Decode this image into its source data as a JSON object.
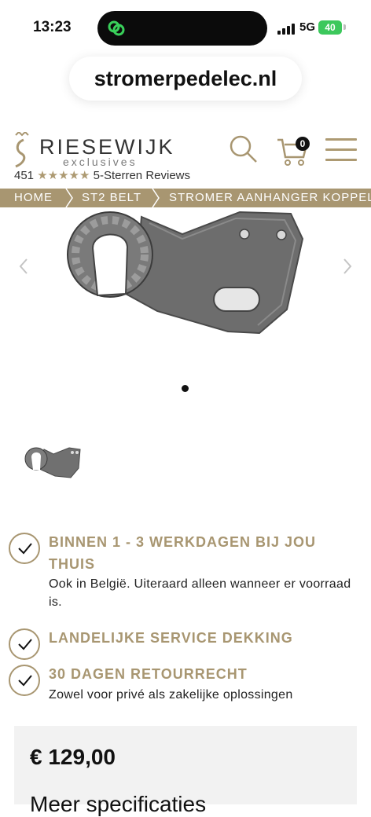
{
  "status_bar": {
    "time": "13:23",
    "network": "5G",
    "battery": "40"
  },
  "browser": {
    "url": "stromerpedelec.nl"
  },
  "header": {
    "brand": "RIESEWIJK",
    "brand_sub": "exclusives",
    "review_count": "451",
    "stars": "★★★★★",
    "review_label": "5-Sterren Reviews",
    "cart_count": "0",
    "accent_color": "#a89671"
  },
  "breadcrumb": {
    "items": [
      "HOME",
      "ST2 BELT",
      "STROMER AANHANGER KOPPELI"
    ]
  },
  "gallery": {
    "prev_icon": "chevron-left-icon",
    "next_icon": "chevron-right-icon",
    "slide_count": 1,
    "active_slide": 1
  },
  "usps": [
    {
      "title": "BINNEN 1 - 3 WERKDAGEN BIJ JOU THUIS",
      "text": "Ook in België. Uiteraard alleen wanneer er voorraad is."
    },
    {
      "title": "LANDELIJKE SERVICE DEKKING",
      "text": ""
    },
    {
      "title": "30 DAGEN RETOURRECHT",
      "text": "Zowel voor privé als zakelijke oplossingen"
    }
  ],
  "product": {
    "price": "€ 129,00",
    "more_specs": "Meer specificaties"
  }
}
